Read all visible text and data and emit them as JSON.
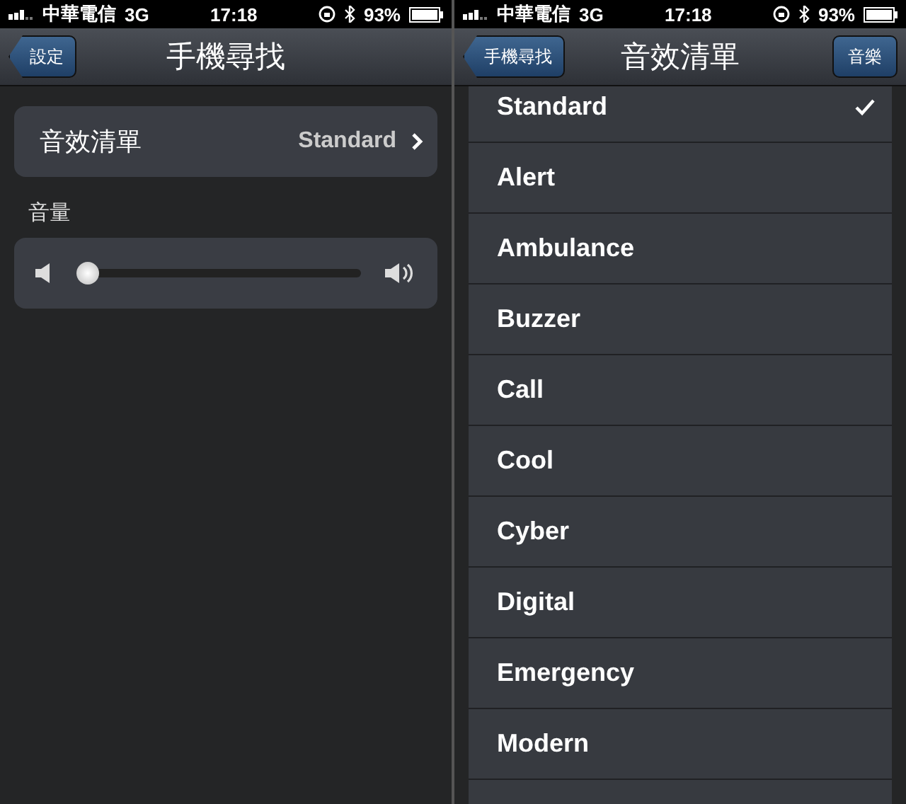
{
  "screens": [
    {
      "status_bar": {
        "carrier": "中華電信",
        "network": "3G",
        "time": "17:18",
        "battery": "93%"
      },
      "nav_bar": {
        "back": "設定",
        "title": "手機尋找"
      },
      "sound_row": {
        "label": "音效清單",
        "value": "Standard"
      },
      "volume": {
        "label": "音量",
        "level": 0.0
      }
    },
    {
      "status_bar": {
        "carrier": "中華電信",
        "network": "3G",
        "time": "17:18",
        "battery": "93%"
      },
      "nav_bar": {
        "back": "手機尋找",
        "title": "音效清單",
        "action": "音樂"
      },
      "sounds": [
        {
          "name": "Standard",
          "selected": true
        },
        {
          "name": "Alert",
          "selected": false
        },
        {
          "name": "Ambulance",
          "selected": false
        },
        {
          "name": "Buzzer",
          "selected": false
        },
        {
          "name": "Call",
          "selected": false
        },
        {
          "name": "Cool",
          "selected": false
        },
        {
          "name": "Cyber",
          "selected": false
        },
        {
          "name": "Digital",
          "selected": false
        },
        {
          "name": "Emergency",
          "selected": false
        },
        {
          "name": "Modern",
          "selected": false
        }
      ]
    }
  ]
}
